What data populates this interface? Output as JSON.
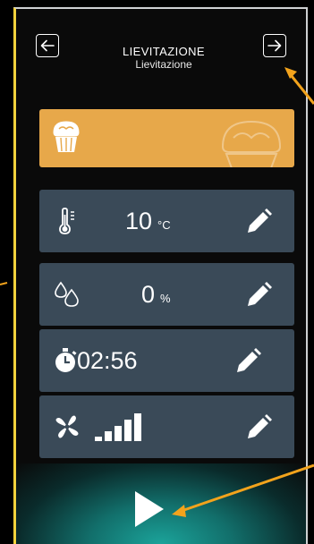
{
  "header": {
    "title": "LIEVITAZIONE",
    "subtitle": "Lievitazione",
    "back_icon": "arrow-left-icon",
    "next_icon": "arrow-right-icon"
  },
  "banner": {
    "icon": "muffin-icon",
    "color": "#e7a84a"
  },
  "settings": {
    "temperature": {
      "icon": "thermometer-icon",
      "value": "10",
      "unit": "°C"
    },
    "humidity": {
      "icon": "water-drops-icon",
      "value": "0",
      "unit": "%"
    },
    "timer": {
      "icon": "stopwatch-icon",
      "value": "02:56"
    },
    "fan": {
      "icon": "fan-icon",
      "level_fraction": 1.0,
      "bars": 5
    }
  },
  "colors": {
    "row_bg": "#3a4a58",
    "accent": "#f2a31c",
    "play_glow": "#1ba39a"
  },
  "play": {
    "icon": "play-icon"
  }
}
